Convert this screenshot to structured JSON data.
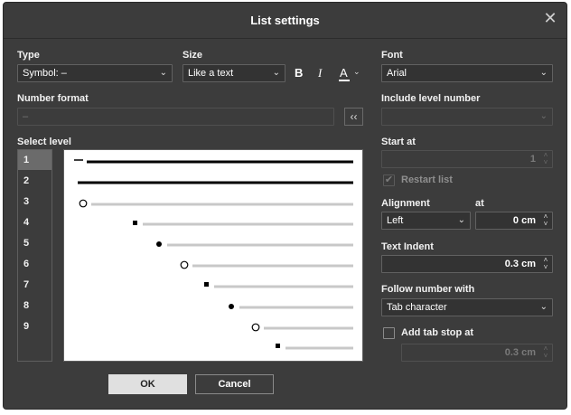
{
  "dialog": {
    "title": "List settings",
    "close_glyph": "✕"
  },
  "type": {
    "label": "Type",
    "value": "Symbol: –"
  },
  "size": {
    "label": "Size",
    "value": "Like a text"
  },
  "format_tools": {
    "bold": "B",
    "italic": "I",
    "color": "A",
    "color_underline": "#ffffff"
  },
  "number_format": {
    "label": "Number format",
    "value": "–",
    "insert_glyph": "‹‹"
  },
  "select_level": {
    "label": "Select level",
    "levels": [
      "1",
      "2",
      "3",
      "4",
      "5",
      "6",
      "7",
      "8",
      "9"
    ],
    "selected": "1"
  },
  "font": {
    "label": "Font",
    "value": "Arial"
  },
  "include_level": {
    "label": "Include level number",
    "value": ""
  },
  "start_at": {
    "label": "Start at",
    "value": "1"
  },
  "restart_list": {
    "label": "Restart list",
    "checked": true,
    "check_glyph": "✔"
  },
  "alignment": {
    "label": "Alignment",
    "value": "Left",
    "at_label": "at",
    "at_value": "0 cm"
  },
  "text_indent": {
    "label": "Text Indent",
    "value": "0.3 cm"
  },
  "follow": {
    "label": "Follow number with",
    "value": "Tab character"
  },
  "tab_stop": {
    "label": "Add tab stop at",
    "value": "0.3 cm"
  },
  "buttons": {
    "ok": "OK",
    "cancel": "Cancel"
  },
  "glyphs": {
    "caret": "⌄",
    "spin_up": "˄",
    "spin_down": "˅"
  },
  "colors": {
    "dialog_bg": "#3c3c3c",
    "selected_level": "#6b6b6b",
    "ok_button": "#e0e0e0"
  }
}
